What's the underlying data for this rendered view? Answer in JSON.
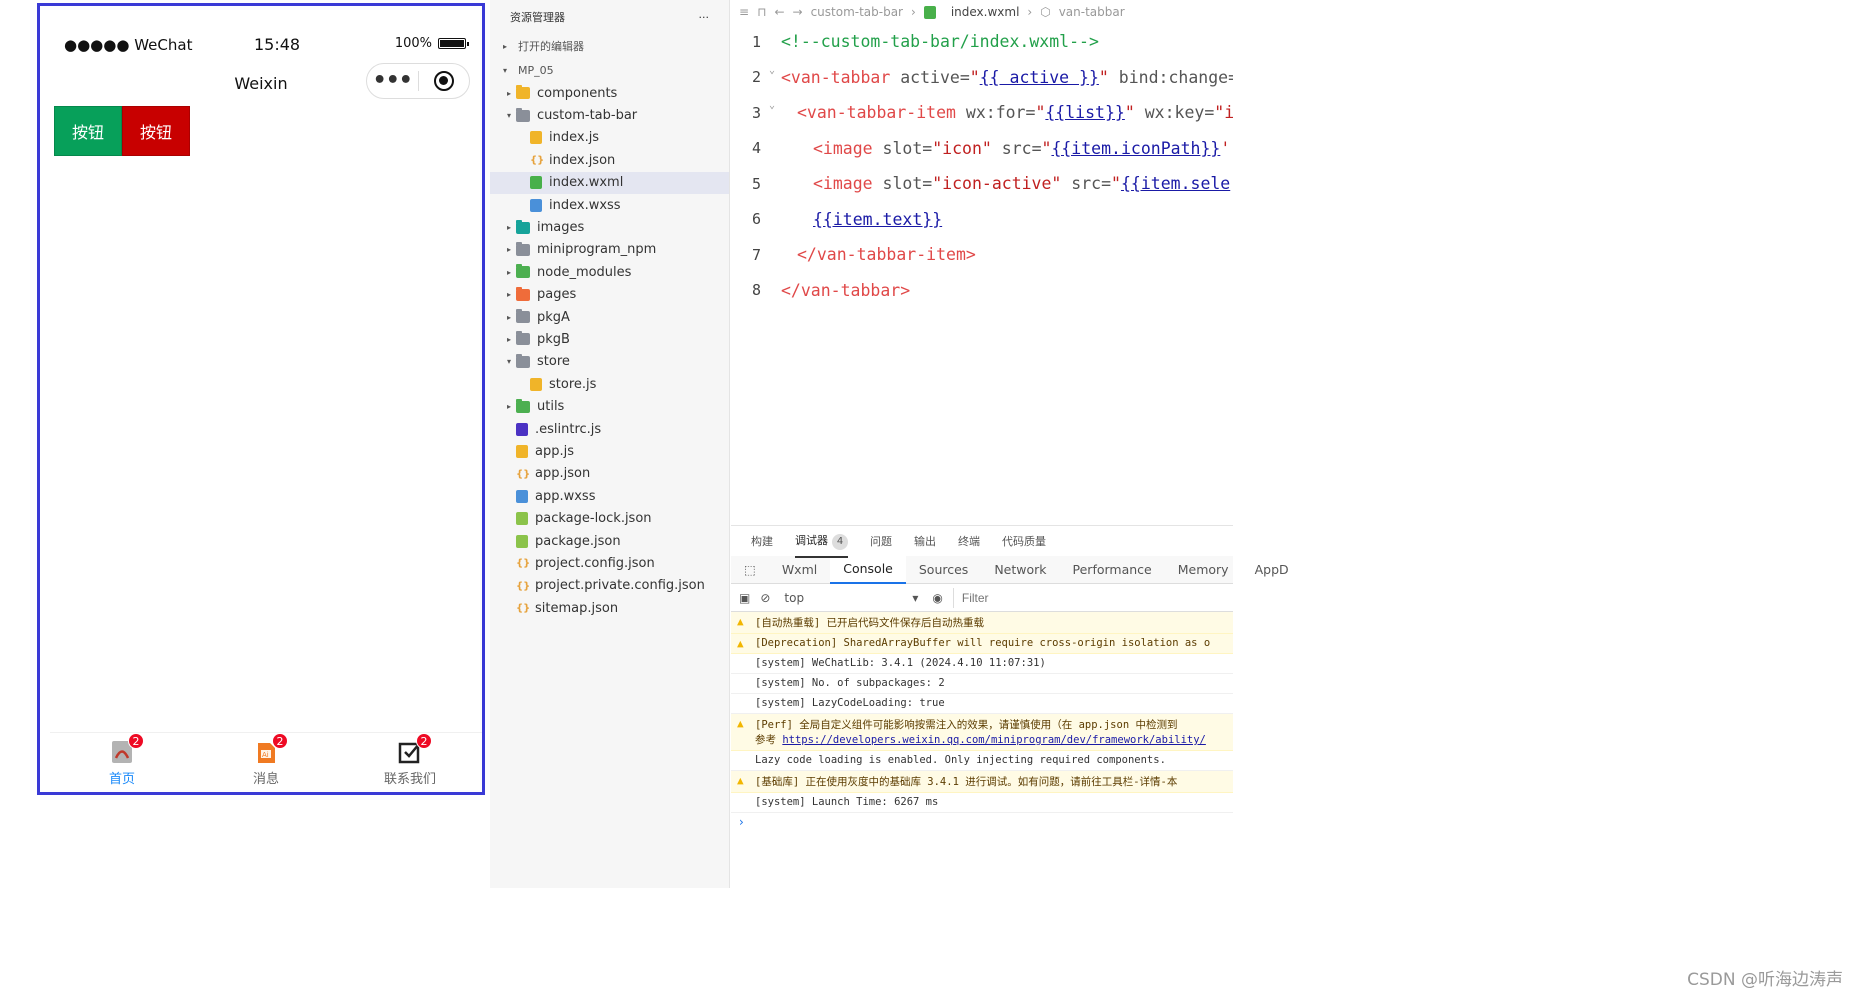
{
  "phone": {
    "carrier": "●●●●● WeChat",
    "time": "15:48",
    "battery": "100%",
    "nav_title": "Weixin",
    "capsule_menu": "•••",
    "buttons": [
      {
        "label": "按钮",
        "color": "#07a05a"
      },
      {
        "label": "按钮",
        "color": "#c80000"
      }
    ],
    "tabbar": [
      {
        "label": "首页",
        "badge": "2",
        "icon": "pdf-icon",
        "active": true
      },
      {
        "label": "消息",
        "badge": "2",
        "icon": "illustrator-icon",
        "active": false
      },
      {
        "label": "联系我们",
        "badge": "2",
        "icon": "checkbox-icon",
        "active": false
      }
    ]
  },
  "explorer": {
    "title": "资源管理器",
    "more": "···",
    "open_editors": "打开的编辑器",
    "project": "MP_05",
    "tree": [
      {
        "name": "components",
        "type": "folder",
        "color": "#f0b429",
        "open": false,
        "indent": 1
      },
      {
        "name": "custom-tab-bar",
        "type": "folder",
        "color": "#8a8f99",
        "open": true,
        "indent": 1
      },
      {
        "name": "index.js",
        "type": "file",
        "color": "#f0b429",
        "indent": 2
      },
      {
        "name": "index.json",
        "type": "json",
        "color": "#e6a23c",
        "indent": 2
      },
      {
        "name": "index.wxml",
        "type": "file",
        "color": "#48b04a",
        "indent": 2,
        "selected": true
      },
      {
        "name": "index.wxss",
        "type": "file",
        "color": "#4a90d9",
        "indent": 2
      },
      {
        "name": "images",
        "type": "folder",
        "color": "#16a39a",
        "open": false,
        "indent": 1
      },
      {
        "name": "miniprogram_npm",
        "type": "folder",
        "color": "#8a8f99",
        "open": false,
        "indent": 1
      },
      {
        "name": "node_modules",
        "type": "folder",
        "color": "#4caf50",
        "open": false,
        "indent": 1
      },
      {
        "name": "pages",
        "type": "folder",
        "color": "#ef6c3a",
        "open": false,
        "indent": 1
      },
      {
        "name": "pkgA",
        "type": "folder",
        "color": "#8a8f99",
        "open": false,
        "indent": 1
      },
      {
        "name": "pkgB",
        "type": "folder",
        "color": "#8a8f99",
        "open": false,
        "indent": 1
      },
      {
        "name": "store",
        "type": "folder",
        "color": "#8a8f99",
        "open": true,
        "indent": 1
      },
      {
        "name": "store.js",
        "type": "file",
        "color": "#f0b429",
        "indent": 2
      },
      {
        "name": "utils",
        "type": "folder",
        "color": "#4caf50",
        "open": false,
        "indent": 1
      },
      {
        "name": ".eslintrc.js",
        "type": "file",
        "color": "#4b32c3",
        "indent": 1
      },
      {
        "name": "app.js",
        "type": "file",
        "color": "#f0b429",
        "indent": 1
      },
      {
        "name": "app.json",
        "type": "json",
        "color": "#e6a23c",
        "indent": 1
      },
      {
        "name": "app.wxss",
        "type": "file",
        "color": "#4a90d9",
        "indent": 1
      },
      {
        "name": "package-lock.json",
        "type": "file",
        "color": "#8bc34a",
        "indent": 1
      },
      {
        "name": "package.json",
        "type": "file",
        "color": "#8bc34a",
        "indent": 1
      },
      {
        "name": "project.config.json",
        "type": "json",
        "color": "#e6a23c",
        "indent": 1
      },
      {
        "name": "project.private.config.json",
        "type": "json",
        "color": "#e6a23c",
        "indent": 1
      },
      {
        "name": "sitemap.json",
        "type": "json",
        "color": "#e6a23c",
        "indent": 1
      }
    ]
  },
  "editor": {
    "breadcrumb": [
      "custom-tab-bar",
      "index.wxml",
      "van-tabbar"
    ],
    "lines": [
      {
        "n": "1",
        "fold": "",
        "indent": 0,
        "tokens": [
          [
            "c-comment",
            "<!--custom-tab-bar/index.wxml-->"
          ]
        ]
      },
      {
        "n": "2",
        "fold": "⌄",
        "indent": 0,
        "tokens": [
          [
            "c-tag",
            "<van-tabbar"
          ],
          [
            "c-attr",
            " active="
          ],
          [
            "c-str",
            "\""
          ],
          [
            "c-mus",
            "{{ active }}"
          ],
          [
            "c-str",
            "\""
          ],
          [
            "c-attr",
            " bind:change="
          ]
        ]
      },
      {
        "n": "3",
        "fold": "⌄",
        "indent": 1,
        "tokens": [
          [
            "c-tag",
            "<van-tabbar-item"
          ],
          [
            "c-attr",
            " wx:for="
          ],
          [
            "c-str",
            "\""
          ],
          [
            "c-mus",
            "{{list}}"
          ],
          [
            "c-str",
            "\""
          ],
          [
            "c-attr",
            " wx:key="
          ],
          [
            "c-str",
            "\"i"
          ]
        ]
      },
      {
        "n": "4",
        "fold": "",
        "indent": 2,
        "tokens": [
          [
            "c-tag",
            "<image"
          ],
          [
            "c-attr",
            " slot="
          ],
          [
            "c-str",
            "\"icon\""
          ],
          [
            "c-attr",
            " src="
          ],
          [
            "c-str",
            "\""
          ],
          [
            "c-mus",
            "{{item.iconPath}}"
          ],
          [
            "c-str",
            "'"
          ]
        ]
      },
      {
        "n": "5",
        "fold": "",
        "indent": 2,
        "tokens": [
          [
            "c-tag",
            "<image"
          ],
          [
            "c-attr",
            " slot="
          ],
          [
            "c-str",
            "\"icon-active\""
          ],
          [
            "c-attr",
            " src="
          ],
          [
            "c-str",
            "\""
          ],
          [
            "c-mus",
            "{{item.sele"
          ]
        ]
      },
      {
        "n": "6",
        "fold": "",
        "indent": 2,
        "tokens": [
          [
            "c-mus",
            "{{item.text}}"
          ]
        ]
      },
      {
        "n": "7",
        "fold": "",
        "indent": 1,
        "tokens": [
          [
            "c-tag",
            "</van-tabbar-item>"
          ]
        ]
      },
      {
        "n": "8",
        "fold": "",
        "indent": 0,
        "tokens": [
          [
            "c-tag",
            "</van-tabbar>"
          ]
        ]
      }
    ]
  },
  "panel": {
    "tabs": [
      "构建",
      "调试器",
      "问题",
      "输出",
      "终端",
      "代码质量"
    ],
    "active_tab": "调试器",
    "debugger_badge": "4",
    "devtools_tabs": [
      "Wxml",
      "Console",
      "Sources",
      "Network",
      "Performance",
      "Memory",
      "AppD"
    ],
    "active_devtools_tab": "Console",
    "context": "top",
    "filter_placeholder": "Filter",
    "logs": [
      {
        "level": "warn",
        "text": "[自动热重载] 已开启代码文件保存后自动热重载"
      },
      {
        "level": "warn",
        "text": "[Deprecation] SharedArrayBuffer will require cross-origin isolation as o"
      },
      {
        "level": "info",
        "text": "[system] WeChatLib: 3.4.1 (2024.4.10 11:07:31)"
      },
      {
        "level": "info",
        "text": "[system] No. of subpackages: 2"
      },
      {
        "level": "info",
        "text": "[system] LazyCodeLoading: true"
      },
      {
        "level": "warn",
        "text": "[Perf] 全局自定义组件可能影响按需注入的效果，请谨慎使用（在 app.json 中检测到",
        "text2": "参考 ",
        "link": "https://developers.weixin.qq.com/miniprogram/dev/framework/ability/"
      },
      {
        "level": "info",
        "text": "Lazy code loading is enabled. Only injecting required components."
      },
      {
        "level": "warn",
        "text": "[基础库] 正在使用灰度中的基础库 3.4.1 进行调试。如有问题，请前往工具栏-详情-本"
      },
      {
        "level": "info",
        "text": "[system] Launch Time: 6267 ms"
      }
    ],
    "prompt": "›"
  },
  "watermark": "CSDN @听海边涛声"
}
